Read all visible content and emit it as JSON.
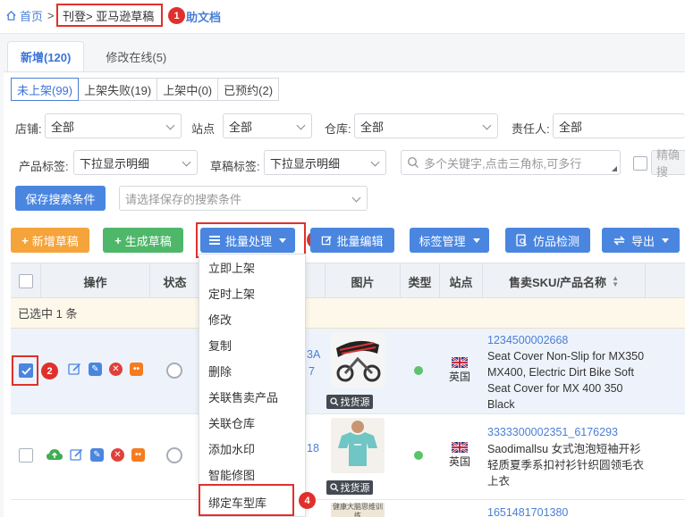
{
  "breadcrumb": {
    "home": "首页",
    "sep": ">",
    "boxed": "刊登> 亚马逊草稿",
    "tail": "助文档"
  },
  "tabs": [
    {
      "label": "新增(120)"
    },
    {
      "label": "修改在线(5)"
    }
  ],
  "subtabs": [
    {
      "label": "未上架(99)"
    },
    {
      "label": "上架失败(19)"
    },
    {
      "label": "上架中(0)"
    },
    {
      "label": "已预约(2)"
    }
  ],
  "filters": {
    "shop_label": "店铺:",
    "shop_value": "全部",
    "site_label": "站点",
    "site_value": "全部",
    "warehouse_label": "仓库:",
    "warehouse_value": "全部",
    "owner_label": "责任人:",
    "owner_value": "全部",
    "product_tag_label": "产品标签:",
    "product_tag_value": "下拉显示明细",
    "draft_tag_label": "草稿标签:",
    "draft_tag_value": "下拉显示明细",
    "keyword_placeholder": "多个关键字,点击三角标,可多行",
    "exact_label": "精确搜",
    "save_search_label": "保存搜索条件",
    "saved_search_placeholder": "请选择保存的搜索条件"
  },
  "toolbar": {
    "add_draft": "新增草稿",
    "gen_draft": "生成草稿",
    "batch_process": "批量处理",
    "batch_edit": "批量编辑",
    "tag_manage": "标签管理",
    "counterfeit_check": "仿品检测",
    "export": "导出"
  },
  "menu": {
    "items": [
      "立即上架",
      "定时上架",
      "修改",
      "复制",
      "删除",
      "关联售卖产品",
      "关联仓库",
      "添加水印",
      "智能修图",
      "绑定车型库"
    ]
  },
  "table": {
    "headers": {
      "ops": "操作",
      "status": "状态",
      "image": "图片",
      "type": "类型",
      "site": "站点",
      "sku_name": "售卖SKU/产品名称"
    },
    "selected_text": "已选中 1 条",
    "rows": [
      {
        "partial_code": "3A",
        "partial_code2": "7",
        "site": "英国",
        "find_source": "找货源",
        "sku": "1234500002668",
        "name": "Seat Cover Non-Slip for MX350 MX400, Electric Dirt Bike Soft Seat Cover for MX 400 350 Black"
      },
      {
        "partial_code": "18",
        "site": "英国",
        "find_source": "找货源",
        "sku": "3333300002351_6176293",
        "name": "Saodimallsu 女式泡泡短袖开衫轻质夏季系扣衬衫针织圆领毛衣上衣"
      },
      {
        "sku": "1651481701380",
        "img_text": "健康大脑思维训练"
      }
    ]
  },
  "annotations": [
    "1",
    "2",
    "3",
    "4"
  ],
  "colors": {
    "accent": "#4a86e0",
    "annotation": "#e0302b",
    "add": "#f5a43b",
    "generate": "#4fb76a"
  }
}
